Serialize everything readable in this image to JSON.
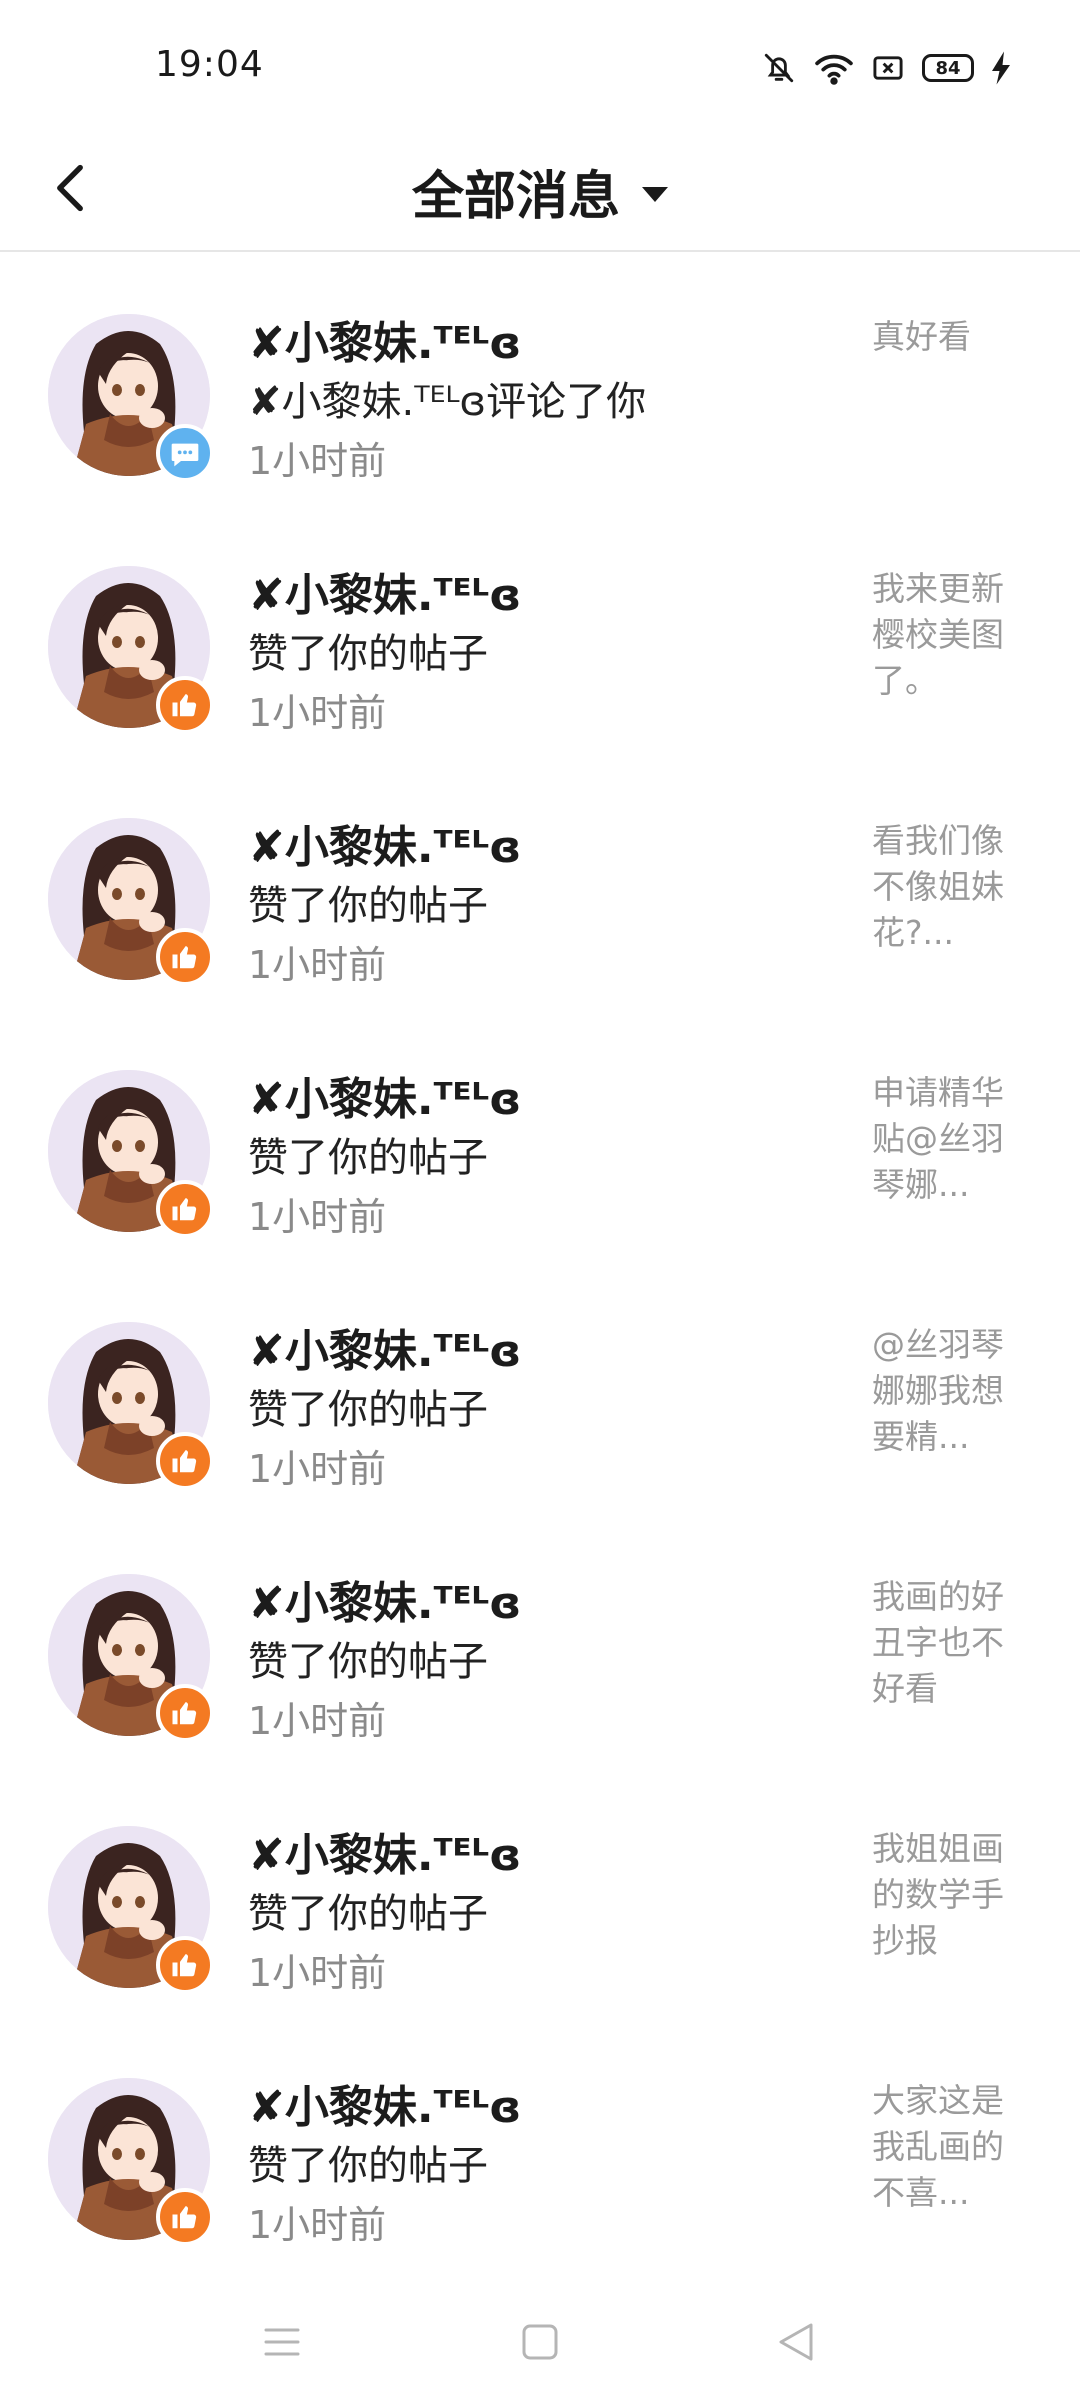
{
  "status_bar": {
    "time": "19:04",
    "icons": [
      "bell-muted-icon",
      "wifi-icon",
      "sim-off-icon",
      "battery-icon",
      "charging-icon"
    ],
    "battery_level": "84"
  },
  "header": {
    "title": "全部消息",
    "back_icon": "chevron-left-icon",
    "dropdown_icon": "caret-down-icon"
  },
  "colors": {
    "like_badge": "#f47a22",
    "comment_badge": "#5fb2ef",
    "muted_text": "#8a8a8a",
    "preview_text": "#9a9a9a"
  },
  "messages": [
    {
      "name": "✘小黎妹.ᵀᴱᴸɞ",
      "action": "✘小黎妹.ᵀᴱᴸɞ评论了你",
      "time": "1小时前",
      "preview": "真好看",
      "badge": "comment-icon"
    },
    {
      "name": "✘小黎妹.ᵀᴱᴸɞ",
      "action": "赞了你的帖子",
      "time": "1小时前",
      "preview": "我来更新樱校美图了。",
      "badge": "thumbs-up-icon"
    },
    {
      "name": "✘小黎妹.ᵀᴱᴸɞ",
      "action": "赞了你的帖子",
      "time": "1小时前",
      "preview": "看我们像不像姐妹花?...",
      "badge": "thumbs-up-icon"
    },
    {
      "name": "✘小黎妹.ᵀᴱᴸɞ",
      "action": "赞了你的帖子",
      "time": "1小时前",
      "preview": "申请精华贴@丝羽琴娜...",
      "badge": "thumbs-up-icon"
    },
    {
      "name": "✘小黎妹.ᵀᴱᴸɞ",
      "action": "赞了你的帖子",
      "time": "1小时前",
      "preview": "@丝羽琴娜娜我想要精...",
      "badge": "thumbs-up-icon"
    },
    {
      "name": "✘小黎妹.ᵀᴱᴸɞ",
      "action": "赞了你的帖子",
      "time": "1小时前",
      "preview": "我画的好丑字也不好看",
      "badge": "thumbs-up-icon"
    },
    {
      "name": "✘小黎妹.ᵀᴱᴸɞ",
      "action": "赞了你的帖子",
      "time": "1小时前",
      "preview": "我姐姐画的数学手抄报",
      "badge": "thumbs-up-icon"
    },
    {
      "name": "✘小黎妹.ᵀᴱᴸɞ",
      "action": "赞了你的帖子",
      "time": "1小时前",
      "preview": "大家这是我乱画的不喜...",
      "badge": "thumbs-up-icon"
    }
  ],
  "nav_bar": {
    "icons": [
      "menu-icon",
      "home-square-icon",
      "back-triangle-icon"
    ]
  }
}
